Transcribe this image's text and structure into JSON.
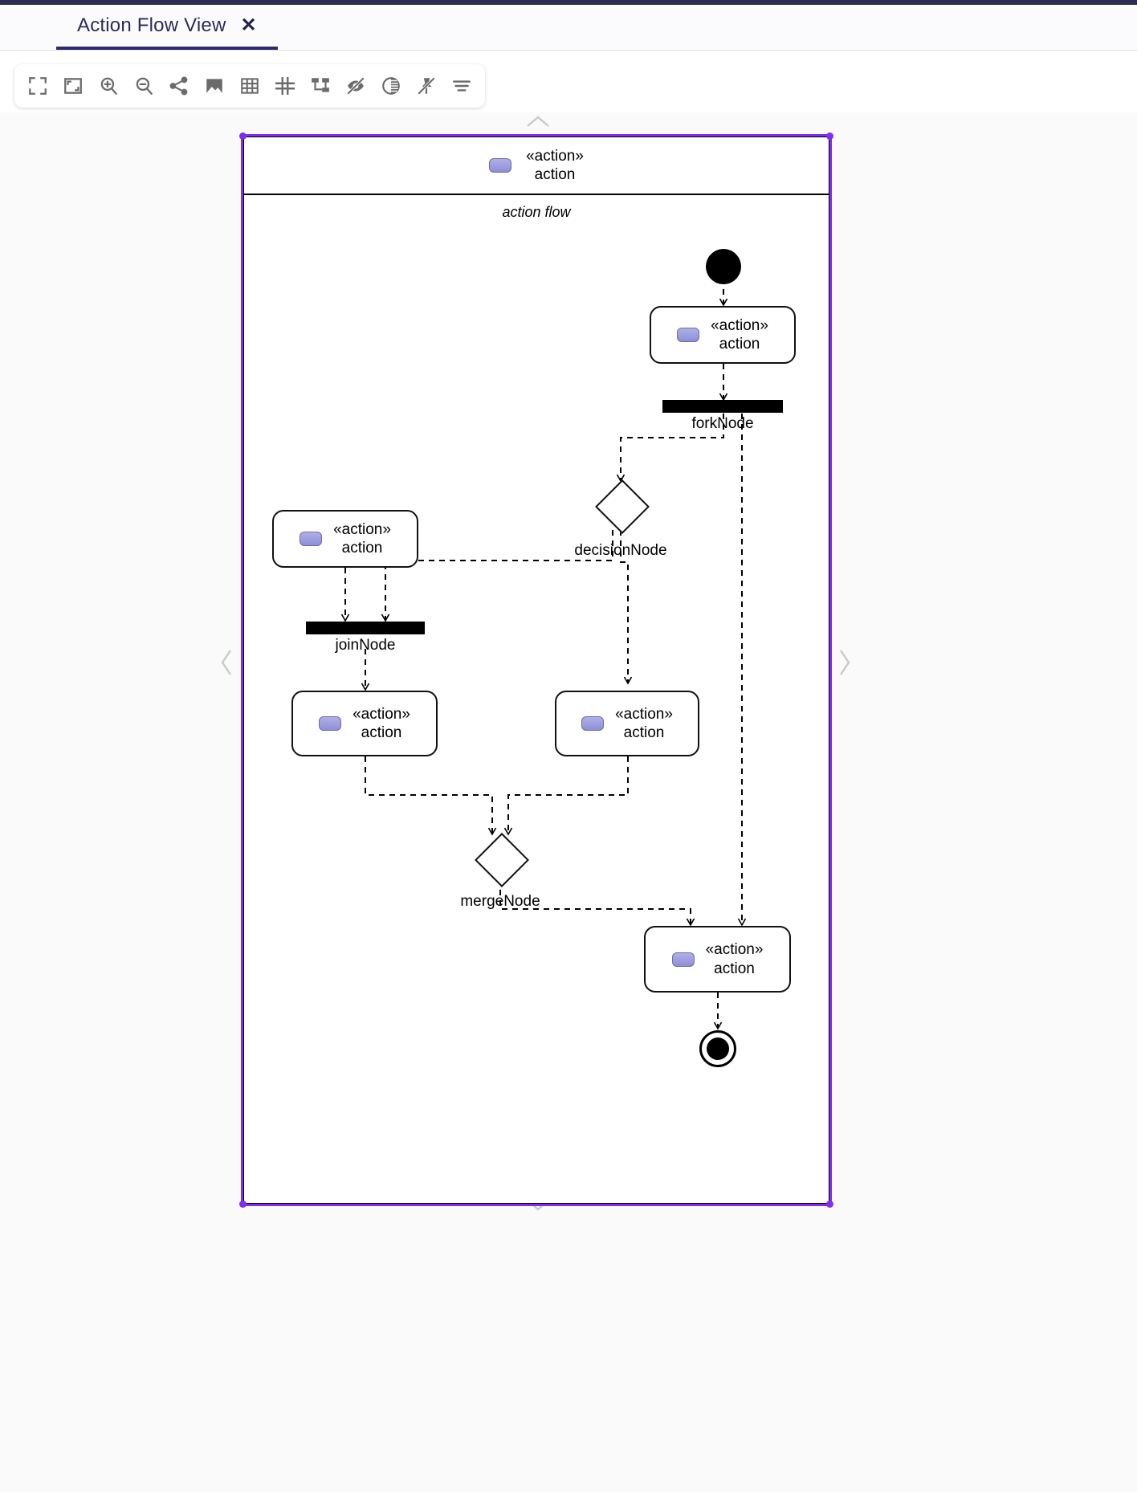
{
  "window": {
    "accent_color": "#2b2b6e",
    "selection_color": "#7c2ff0"
  },
  "tabs": [
    {
      "label": "Action Flow View",
      "close_label": "✕",
      "active": true
    }
  ],
  "toolbar": {
    "buttons": [
      {
        "name": "fit-screen-icon",
        "tooltip": "Fit to screen"
      },
      {
        "name": "fit-content-icon",
        "tooltip": "Fit to content"
      },
      {
        "name": "zoom-in-icon",
        "tooltip": "Zoom in"
      },
      {
        "name": "zoom-out-icon",
        "tooltip": "Zoom out"
      },
      {
        "name": "share-icon",
        "tooltip": "Share"
      },
      {
        "name": "image-icon",
        "tooltip": "Export image"
      },
      {
        "name": "grid-icon",
        "tooltip": "Grid"
      },
      {
        "name": "snap-grid-icon",
        "tooltip": "Snap to grid"
      },
      {
        "name": "layout-icon",
        "tooltip": "Auto layout"
      },
      {
        "name": "hide-icon",
        "tooltip": "Hide elements"
      },
      {
        "name": "contrast-icon",
        "tooltip": "Contrast"
      },
      {
        "name": "pin-off-icon",
        "tooltip": "Unpin"
      },
      {
        "name": "list-icon",
        "tooltip": "Filter"
      }
    ]
  },
  "navigation": {
    "up": "⌃",
    "down": "⌄",
    "left": "‹",
    "right": "›"
  },
  "diagram": {
    "frame": {
      "stereotype": "«action»",
      "name": "action",
      "compartment_label": "action flow"
    },
    "nodes": [
      {
        "id": "initial",
        "type": "initial-node",
        "label": ""
      },
      {
        "id": "action1",
        "type": "action-node",
        "stereotype": "«action»",
        "label": "action"
      },
      {
        "id": "fork",
        "type": "fork-node",
        "label": "forkNode"
      },
      {
        "id": "decision",
        "type": "decision-node",
        "label": "decisionNode"
      },
      {
        "id": "action2",
        "type": "action-node",
        "stereotype": "«action»",
        "label": "action"
      },
      {
        "id": "join",
        "type": "join-node",
        "label": "joinNode"
      },
      {
        "id": "action3",
        "type": "action-node",
        "stereotype": "«action»",
        "label": "action"
      },
      {
        "id": "action4",
        "type": "action-node",
        "stereotype": "«action»",
        "label": "action"
      },
      {
        "id": "merge",
        "type": "merge-node",
        "label": "mergeNode"
      },
      {
        "id": "action5",
        "type": "action-node",
        "stereotype": "«action»",
        "label": "action"
      },
      {
        "id": "final",
        "type": "final-node",
        "label": ""
      }
    ]
  }
}
